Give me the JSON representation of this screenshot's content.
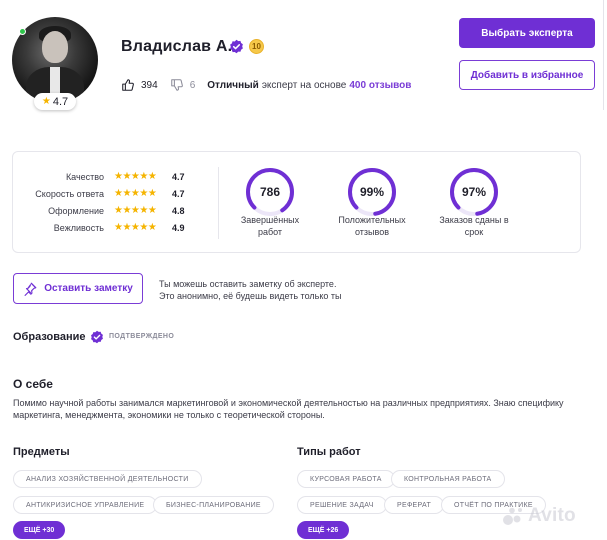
{
  "profile": {
    "name": "Владислав А.",
    "level": "10",
    "rating": "4.7",
    "likes": "394",
    "dislikes": "6",
    "summary_bold": "Отличный",
    "summary_mid": "эксперт на основе",
    "summary_reviews": "400 отзывов"
  },
  "actions": {
    "choose_expert": "Выбрать эксперта",
    "add_favorite": "Добавить в избранное"
  },
  "metrics": [
    {
      "label": "Качество",
      "value": "4.7",
      "stars": 5
    },
    {
      "label": "Скорость ответа",
      "value": "4.7",
      "stars": 5
    },
    {
      "label": "Оформление",
      "value": "4.8",
      "stars": 5
    },
    {
      "label": "Вежливость",
      "value": "4.9",
      "stars": 5
    }
  ],
  "rings": [
    {
      "value": "786",
      "label_line1": "Завершённых",
      "label_line2": "работ",
      "fill": 0.78
    },
    {
      "value": "99%",
      "label_line1": "Положительных",
      "label_line2": "отзывов",
      "fill": 0.85
    },
    {
      "value": "97%",
      "label_line1": "Заказов сданы в",
      "label_line2": "срок",
      "fill": 0.85
    }
  ],
  "note": {
    "button": "Оставить заметку",
    "hint_line1": "Ты можешь оставить заметку об эксперте.",
    "hint_line2": "Это анонимно, её будешь видеть только ты"
  },
  "education": {
    "title": "Образование",
    "status": "ПОДТВЕРЖДЕНО"
  },
  "about": {
    "title": "О себе",
    "text": "Помимо научной работы занимался маркетинговой и экономической деятельностью на различных предприятиях. Знаю специфику маркетинга, менеджмента, экономики не только с теоретической стороны."
  },
  "subjects": {
    "title": "Предметы",
    "tags": [
      "АНАЛИЗ ХОЗЯЙСТВЕННОЙ ДЕЯТЕЛЬНОСТИ",
      "АНТИКРИЗИСНОЕ УПРАВЛЕНИЕ",
      "БИЗНЕС-ПЛАНИРОВАНИЕ"
    ],
    "more": "ЕЩЁ +30"
  },
  "work_types": {
    "title": "Типы работ",
    "tags": [
      "КУРСОВАЯ РАБОТА",
      "КОНТРОЛЬНАЯ РАБОТА",
      "РЕШЕНИЕ ЗАДАЧ",
      "РЕФЕРАТ",
      "ОТЧЁТ ПО ПРАКТИКЕ"
    ],
    "more": "ЕЩЁ +26"
  },
  "watermark": "Avito",
  "colors": {
    "accent": "#6f2fd4",
    "star": "#f5b400",
    "online": "#2fc54b"
  }
}
